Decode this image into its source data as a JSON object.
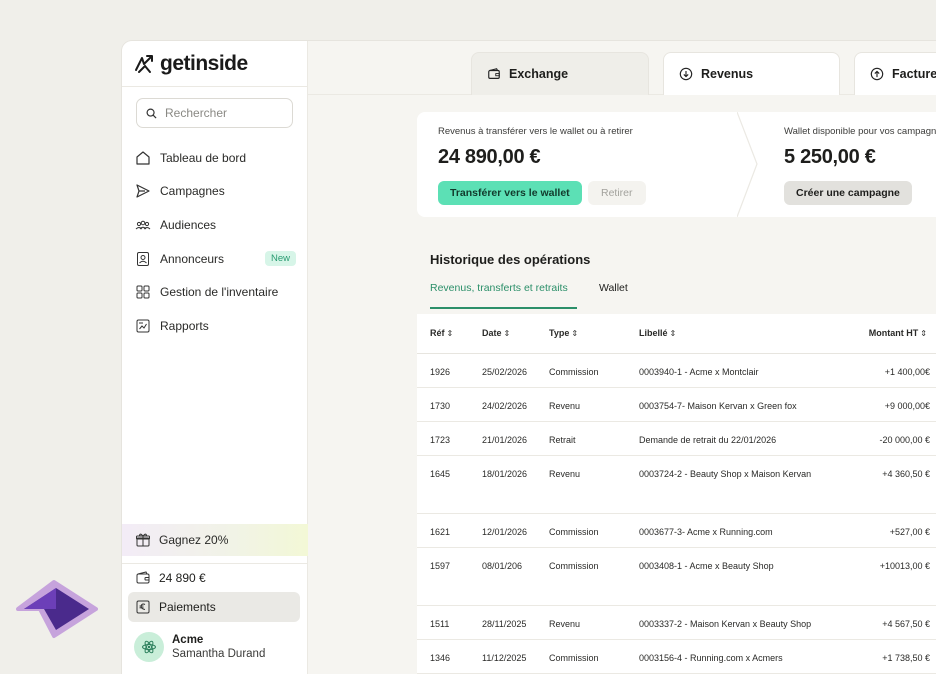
{
  "brand": {
    "name": "getinside"
  },
  "sidebar": {
    "search_placeholder": "Rechercher",
    "items": [
      {
        "label": "Tableau de bord",
        "icon": "home-icon"
      },
      {
        "label": "Campagnes",
        "icon": "send-icon"
      },
      {
        "label": "Audiences",
        "icon": "people-icon"
      },
      {
        "label": "Annonceurs",
        "icon": "contact-card-icon",
        "badge": "New"
      },
      {
        "label": "Gestion de l'inventaire",
        "icon": "grid-icon"
      },
      {
        "label": "Rapports",
        "icon": "report-icon"
      }
    ],
    "promo": "Gagnez 20%",
    "wallet_balance": "24 890 €",
    "payments": "Paiements",
    "user": {
      "org": "Acme",
      "name": "Samantha Durand"
    }
  },
  "tabs": [
    {
      "label": "Exchange",
      "icon": "wallet-icon",
      "active": true
    },
    {
      "label": "Revenus",
      "icon": "arrow-down-circle-icon",
      "active": false
    },
    {
      "label": "Facture",
      "icon": "arrow-up-circle-icon",
      "active": false
    }
  ],
  "exchange": {
    "revenue_label": "Revenus à transférer vers le wallet ou à retirer",
    "revenue_amount": "24 890,00 €",
    "transfer_button": "Transférer vers le wallet",
    "withdraw_button": "Retirer",
    "wallet_label": "Wallet disponible pour vos campagn",
    "wallet_amount": "5 250,00 €",
    "create_button": "Créer une campagne"
  },
  "history": {
    "title": "Historique des opérations",
    "tab_active": "Revenus, transferts et retraits",
    "tab_other": "Wallet",
    "columns": {
      "ref": "Réf",
      "date": "Date",
      "type": "Type",
      "label": "Libellé",
      "amount": "Montant HT"
    },
    "rows": [
      {
        "ref": "1926",
        "date": "25/02/2026",
        "type": "Commission",
        "label": "0003940-1 - Acme x Montclair",
        "amount": "+1 400,00€"
      },
      {
        "ref": "1730",
        "date": "24/02/2026",
        "type": "Revenu",
        "label": "0003754-7- Maison Kervan x Green fox",
        "amount": "+9 000,00€"
      },
      {
        "ref": "1723",
        "date": "21/01/2026",
        "type": "Retrait",
        "label": "Demande de retrait du 22/01/2026",
        "amount": "-20 000,00 €"
      },
      {
        "ref": "1645",
        "date": "18/01/2026",
        "type": "Revenu",
        "label": "0003724-2 - Beauty Shop x Maison Kervan",
        "amount": "+4 360,50 €"
      },
      {
        "ref": "1621",
        "date": "12/01/2026",
        "type": "Commission",
        "label": "0003677-3- Acme  x Running.com",
        "amount": "+527,00 €"
      },
      {
        "ref": "1597",
        "date": "08/01/206",
        "type": "Commission",
        "label": "0003408-1 - Acme x Beauty Shop",
        "amount": "+10013,00 €"
      },
      {
        "ref": "1511",
        "date": "28/11/2025",
        "type": "Revenu",
        "label": "0003337-2 - Maison Kervan x Beauty Shop",
        "amount": "+4 567,50 €"
      },
      {
        "ref": "1346",
        "date": "11/12/2025",
        "type": "Commission",
        "label": "0003156-4 - Running.com x Acmers",
        "amount": "+1 738,50 €"
      }
    ]
  },
  "colors": {
    "accent_green": "#5ce0b5",
    "tab_green": "#2b8f69",
    "cursor_purple": "#4a2a8c"
  }
}
